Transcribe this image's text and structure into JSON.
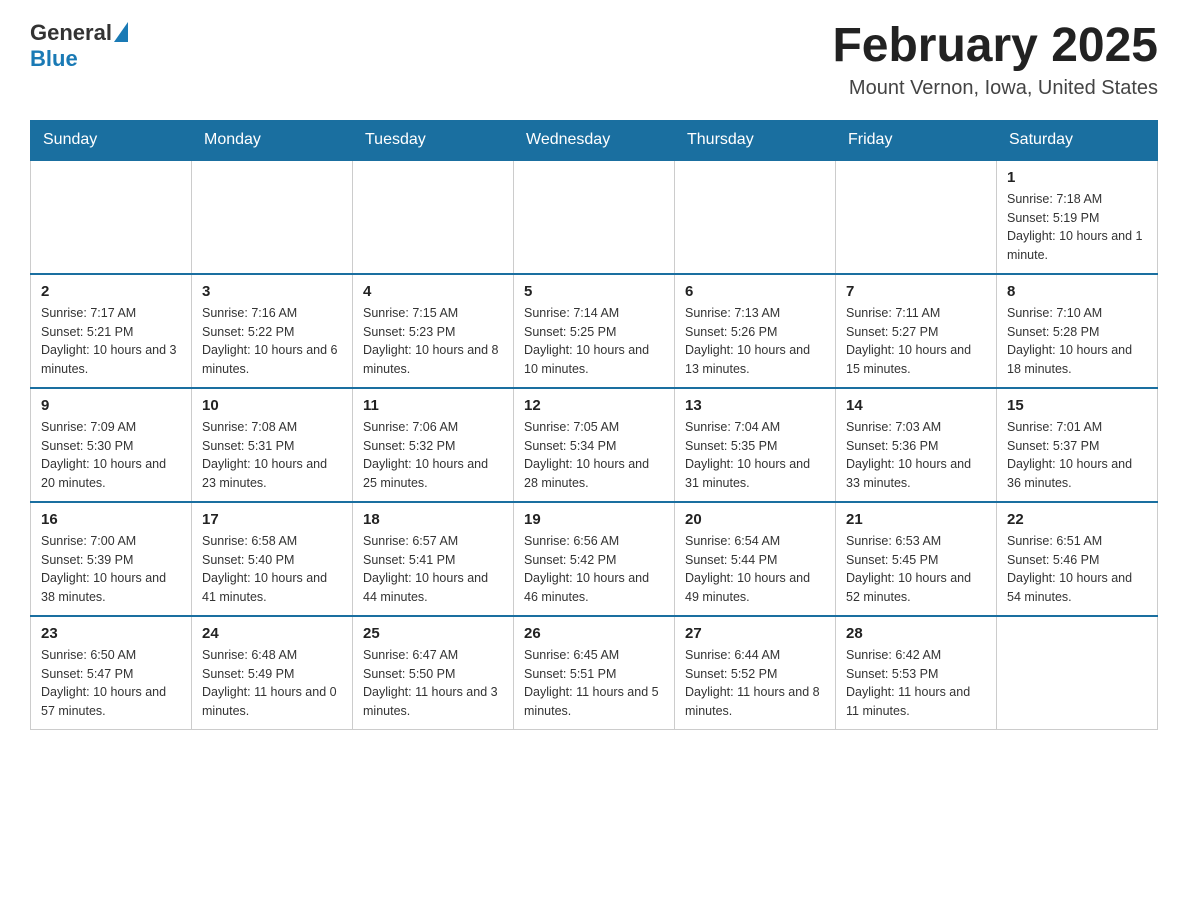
{
  "header": {
    "logo_general": "General",
    "logo_blue": "Blue",
    "month_title": "February 2025",
    "location": "Mount Vernon, Iowa, United States"
  },
  "days_of_week": [
    "Sunday",
    "Monday",
    "Tuesday",
    "Wednesday",
    "Thursday",
    "Friday",
    "Saturday"
  ],
  "weeks": [
    [
      {
        "day": "",
        "info": ""
      },
      {
        "day": "",
        "info": ""
      },
      {
        "day": "",
        "info": ""
      },
      {
        "day": "",
        "info": ""
      },
      {
        "day": "",
        "info": ""
      },
      {
        "day": "",
        "info": ""
      },
      {
        "day": "1",
        "info": "Sunrise: 7:18 AM\nSunset: 5:19 PM\nDaylight: 10 hours and 1 minute."
      }
    ],
    [
      {
        "day": "2",
        "info": "Sunrise: 7:17 AM\nSunset: 5:21 PM\nDaylight: 10 hours and 3 minutes."
      },
      {
        "day": "3",
        "info": "Sunrise: 7:16 AM\nSunset: 5:22 PM\nDaylight: 10 hours and 6 minutes."
      },
      {
        "day": "4",
        "info": "Sunrise: 7:15 AM\nSunset: 5:23 PM\nDaylight: 10 hours and 8 minutes."
      },
      {
        "day": "5",
        "info": "Sunrise: 7:14 AM\nSunset: 5:25 PM\nDaylight: 10 hours and 10 minutes."
      },
      {
        "day": "6",
        "info": "Sunrise: 7:13 AM\nSunset: 5:26 PM\nDaylight: 10 hours and 13 minutes."
      },
      {
        "day": "7",
        "info": "Sunrise: 7:11 AM\nSunset: 5:27 PM\nDaylight: 10 hours and 15 minutes."
      },
      {
        "day": "8",
        "info": "Sunrise: 7:10 AM\nSunset: 5:28 PM\nDaylight: 10 hours and 18 minutes."
      }
    ],
    [
      {
        "day": "9",
        "info": "Sunrise: 7:09 AM\nSunset: 5:30 PM\nDaylight: 10 hours and 20 minutes."
      },
      {
        "day": "10",
        "info": "Sunrise: 7:08 AM\nSunset: 5:31 PM\nDaylight: 10 hours and 23 minutes."
      },
      {
        "day": "11",
        "info": "Sunrise: 7:06 AM\nSunset: 5:32 PM\nDaylight: 10 hours and 25 minutes."
      },
      {
        "day": "12",
        "info": "Sunrise: 7:05 AM\nSunset: 5:34 PM\nDaylight: 10 hours and 28 minutes."
      },
      {
        "day": "13",
        "info": "Sunrise: 7:04 AM\nSunset: 5:35 PM\nDaylight: 10 hours and 31 minutes."
      },
      {
        "day": "14",
        "info": "Sunrise: 7:03 AM\nSunset: 5:36 PM\nDaylight: 10 hours and 33 minutes."
      },
      {
        "day": "15",
        "info": "Sunrise: 7:01 AM\nSunset: 5:37 PM\nDaylight: 10 hours and 36 minutes."
      }
    ],
    [
      {
        "day": "16",
        "info": "Sunrise: 7:00 AM\nSunset: 5:39 PM\nDaylight: 10 hours and 38 minutes."
      },
      {
        "day": "17",
        "info": "Sunrise: 6:58 AM\nSunset: 5:40 PM\nDaylight: 10 hours and 41 minutes."
      },
      {
        "day": "18",
        "info": "Sunrise: 6:57 AM\nSunset: 5:41 PM\nDaylight: 10 hours and 44 minutes."
      },
      {
        "day": "19",
        "info": "Sunrise: 6:56 AM\nSunset: 5:42 PM\nDaylight: 10 hours and 46 minutes."
      },
      {
        "day": "20",
        "info": "Sunrise: 6:54 AM\nSunset: 5:44 PM\nDaylight: 10 hours and 49 minutes."
      },
      {
        "day": "21",
        "info": "Sunrise: 6:53 AM\nSunset: 5:45 PM\nDaylight: 10 hours and 52 minutes."
      },
      {
        "day": "22",
        "info": "Sunrise: 6:51 AM\nSunset: 5:46 PM\nDaylight: 10 hours and 54 minutes."
      }
    ],
    [
      {
        "day": "23",
        "info": "Sunrise: 6:50 AM\nSunset: 5:47 PM\nDaylight: 10 hours and 57 minutes."
      },
      {
        "day": "24",
        "info": "Sunrise: 6:48 AM\nSunset: 5:49 PM\nDaylight: 11 hours and 0 minutes."
      },
      {
        "day": "25",
        "info": "Sunrise: 6:47 AM\nSunset: 5:50 PM\nDaylight: 11 hours and 3 minutes."
      },
      {
        "day": "26",
        "info": "Sunrise: 6:45 AM\nSunset: 5:51 PM\nDaylight: 11 hours and 5 minutes."
      },
      {
        "day": "27",
        "info": "Sunrise: 6:44 AM\nSunset: 5:52 PM\nDaylight: 11 hours and 8 minutes."
      },
      {
        "day": "28",
        "info": "Sunrise: 6:42 AM\nSunset: 5:53 PM\nDaylight: 11 hours and 11 minutes."
      },
      {
        "day": "",
        "info": ""
      }
    ]
  ]
}
